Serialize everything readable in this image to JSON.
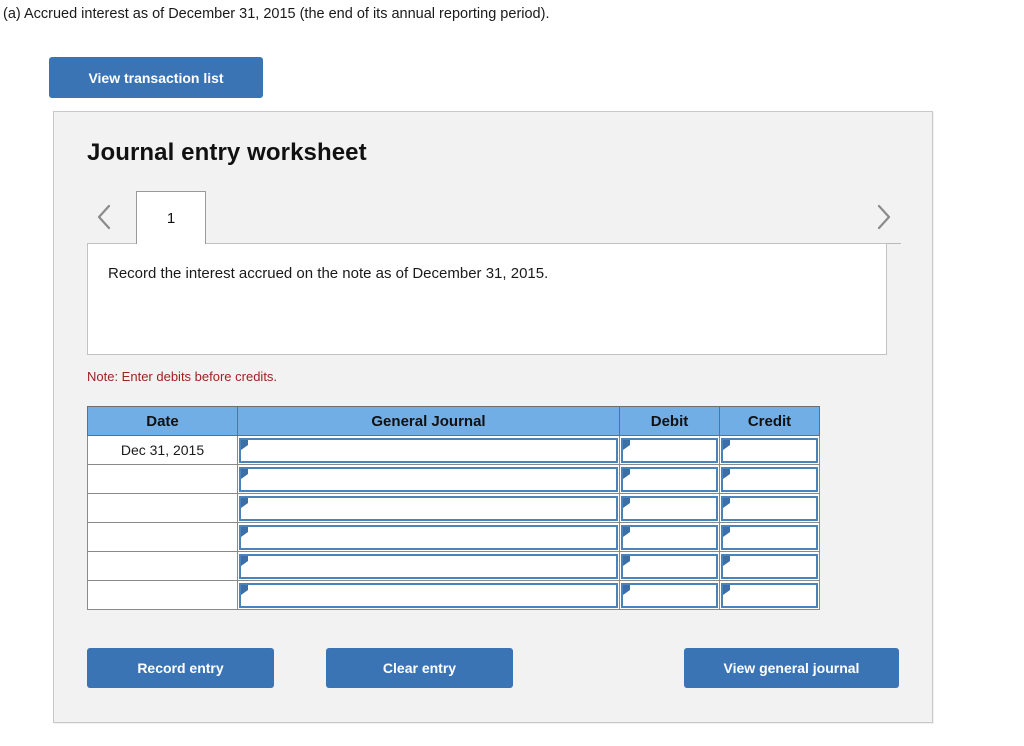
{
  "question": {
    "prompt": "(a) Accrued interest as of December 31, 2015 (the end of its annual reporting period)."
  },
  "toolbar": {
    "view_transaction_list_label": "View transaction list"
  },
  "panel": {
    "title": "Journal entry worksheet",
    "tabs": [
      {
        "label": "1",
        "active": true
      }
    ],
    "nav": {
      "prev_icon": "chevron-left-icon",
      "next_icon": "chevron-right-icon"
    },
    "instruction": "Record the interest accrued on the note as of December 31, 2015.",
    "note": "Note: Enter debits before credits."
  },
  "journal": {
    "columns": [
      "Date",
      "General Journal",
      "Debit",
      "Credit"
    ],
    "rows": [
      {
        "date": "Dec 31, 2015",
        "account": "",
        "debit": "",
        "credit": ""
      },
      {
        "date": "",
        "account": "",
        "debit": "",
        "credit": ""
      },
      {
        "date": "",
        "account": "",
        "debit": "",
        "credit": ""
      },
      {
        "date": "",
        "account": "",
        "debit": "",
        "credit": ""
      },
      {
        "date": "",
        "account": "",
        "debit": "",
        "credit": ""
      },
      {
        "date": "",
        "account": "",
        "debit": "",
        "credit": ""
      }
    ]
  },
  "actions": {
    "record_entry_label": "Record entry",
    "clear_entry_label": "Clear entry",
    "view_general_journal_label": "View general journal"
  },
  "colors": {
    "button_blue": "#3b74b5",
    "header_blue": "#72aee6",
    "cell_outline_blue": "#4a82ba",
    "note_red": "#a02222",
    "panel_bg": "#f2f2f2"
  }
}
